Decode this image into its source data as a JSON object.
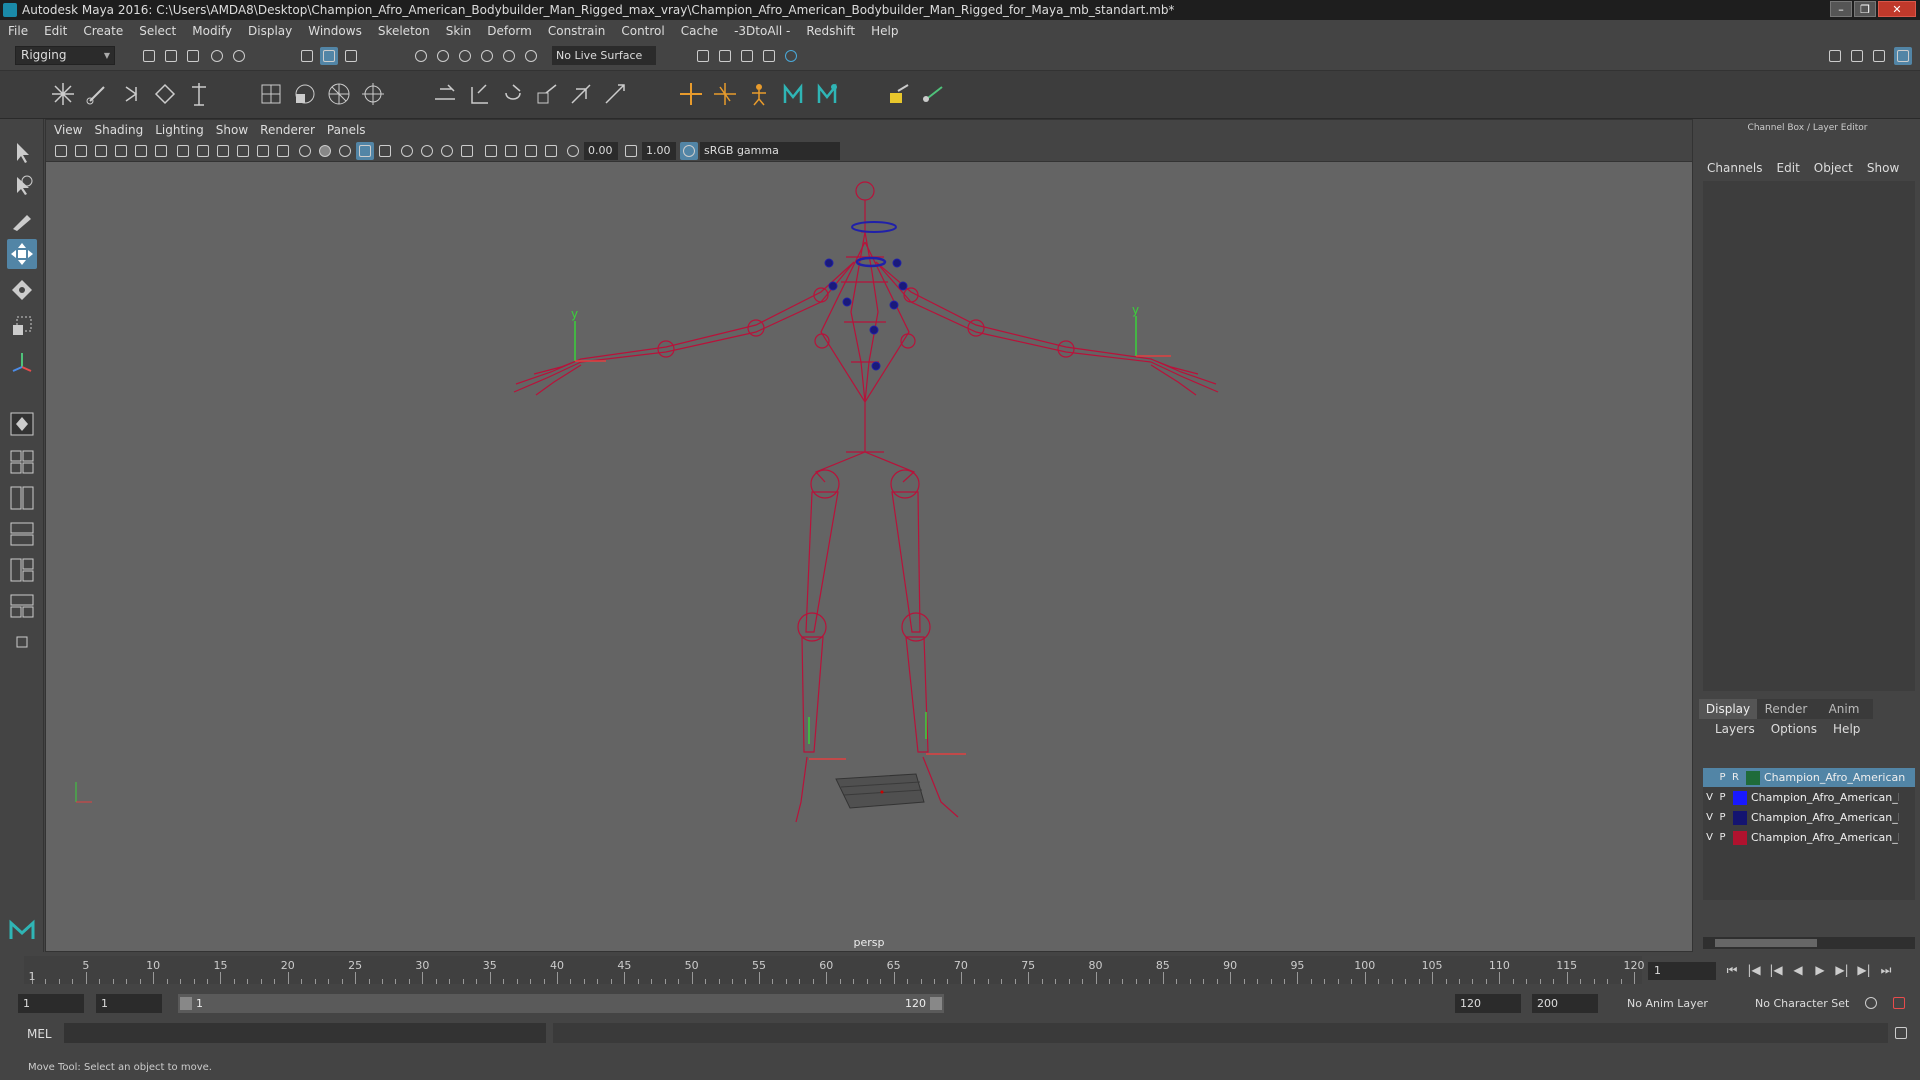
{
  "window": {
    "title": "Autodesk Maya 2016: C:\\Users\\AMDA8\\Desktop\\Champion_Afro_American_Bodybuilder_Man_Rigged_max_vray\\Champion_Afro_American_Bodybuilder_Man_Rigged_for_Maya_mb_standart.mb*",
    "minimize": "–",
    "maximize": "❐",
    "close": "✕"
  },
  "menubar": [
    "File",
    "Edit",
    "Create",
    "Select",
    "Modify",
    "Display",
    "Windows",
    "Skeleton",
    "Skin",
    "Deform",
    "Constrain",
    "Control",
    "Cache",
    "-3DtoAll -",
    "Redshift",
    "Help"
  ],
  "statusline": {
    "mode": "Rigging",
    "live_surface": "No Live Surface"
  },
  "viewport": {
    "menus": [
      "View",
      "Shading",
      "Lighting",
      "Show",
      "Renderer",
      "Panels"
    ],
    "exposure": "0.00",
    "gamma": "1.00",
    "colorspace": "sRGB gamma",
    "camera": "persp"
  },
  "channelbox": {
    "title": "Channel Box / Layer Editor",
    "menus": [
      "Channels",
      "Edit",
      "Object",
      "Show"
    ],
    "tabs": [
      "Display",
      "Render",
      "Anim"
    ],
    "active_tab": "Display",
    "layer_menus": [
      "Layers",
      "Options",
      "Help"
    ],
    "layers": [
      {
        "v": "",
        "p": "P",
        "r": "R",
        "name": "Champion_Afro_American",
        "color": "#1f6b3a",
        "selected": true
      },
      {
        "v": "V",
        "p": "P",
        "r": "",
        "name": "Champion_Afro_American_Bo",
        "color": "#1818ff",
        "selected": false
      },
      {
        "v": "V",
        "p": "P",
        "r": "",
        "name": "Champion_Afro_American_Bo",
        "color": "#141470",
        "selected": false
      },
      {
        "v": "V",
        "p": "P",
        "r": "",
        "name": "Champion_Afro_American_Bo",
        "color": "#b0122e",
        "selected": false
      }
    ]
  },
  "timeline": {
    "ticks": [
      "1",
      "5",
      "10",
      "15",
      "20",
      "25",
      "30",
      "35",
      "40",
      "45",
      "50",
      "55",
      "60",
      "65",
      "70",
      "75",
      "80",
      "85",
      "90",
      "95",
      "100",
      "105",
      "110",
      "115",
      "120"
    ],
    "current_frame": "1",
    "play_buttons": [
      "⏮",
      "⏮",
      "|◀",
      "◀",
      "▶",
      "▶|",
      "⏭",
      "⏭"
    ]
  },
  "range": {
    "start": "1",
    "anim_start": "1",
    "slider_start": "1",
    "slider_end": "120",
    "anim_end": "120",
    "end": "200",
    "anim_layer": "No Anim Layer",
    "character_set": "No Character Set"
  },
  "command": {
    "label": "MEL"
  },
  "help": "Move Tool: Select an object to move."
}
